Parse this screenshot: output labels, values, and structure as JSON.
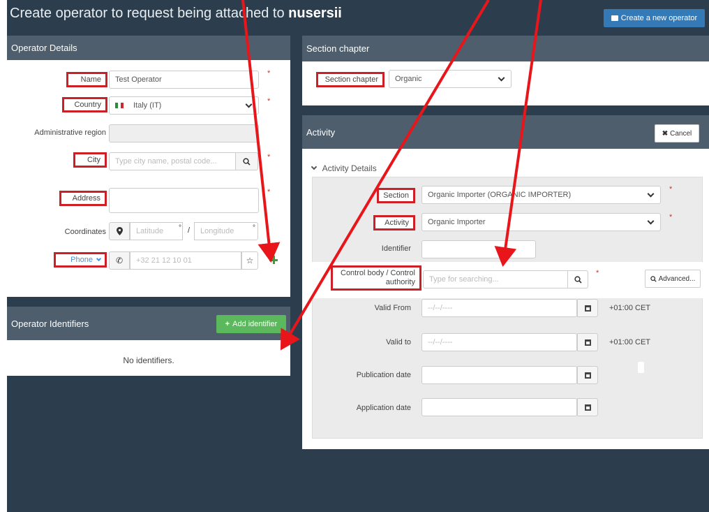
{
  "header": {
    "title_prefix": "Create operator to request being attached to",
    "title_entity": "nusersii",
    "create_button": "Create a new operator"
  },
  "operator_details": {
    "title": "Operator Details",
    "name_label": "Name",
    "name_value": "Test Operator",
    "country_label": "Country",
    "country_value": "Italy (IT)",
    "admin_region_label": "Administrative region",
    "city_label": "City",
    "city_placeholder": "Type city name, postal code...",
    "address_label": "Address",
    "coordinates_label": "Coordinates",
    "latitude_placeholder": "Latitude",
    "longitude_placeholder": "Longitude",
    "coord_separator": "/",
    "degree": "°",
    "phone_label": "Phone",
    "phone_placeholder": "+32 21 12 10 01",
    "required_mark": "*"
  },
  "operator_identifiers": {
    "title": "Operator Identifiers",
    "add_button": "Add identifier",
    "empty_text": "No identifiers."
  },
  "section_chapter": {
    "title": "Section chapter",
    "label": "Section chapter",
    "value": "Organic"
  },
  "activity": {
    "title": "Activity",
    "cancel_button": "Cancel",
    "details_toggle": "Activity Details",
    "section_label": "Section",
    "section_value": "Organic Importer (ORGANIC IMPORTER)",
    "activity_label": "Activity",
    "activity_value": "Organic Importer",
    "identifier_label": "Identifier",
    "control_body_label": "Control body / Control authority",
    "control_body_placeholder": "Type for searching...",
    "advanced_button": "Advanced...",
    "valid_from_label": "Valid From",
    "valid_to_label": "Valid to",
    "publication_label": "Publication date",
    "application_label": "Application date",
    "date_placeholder": "--/--/----",
    "timezone": "+01:00 CET",
    "required_mark": "*"
  },
  "colors": {
    "background": "#2c3e4d",
    "panel_header": "#4e5e6c",
    "primary": "#337ab7",
    "success": "#5cb85c",
    "annotation_red": "#e8161b"
  }
}
